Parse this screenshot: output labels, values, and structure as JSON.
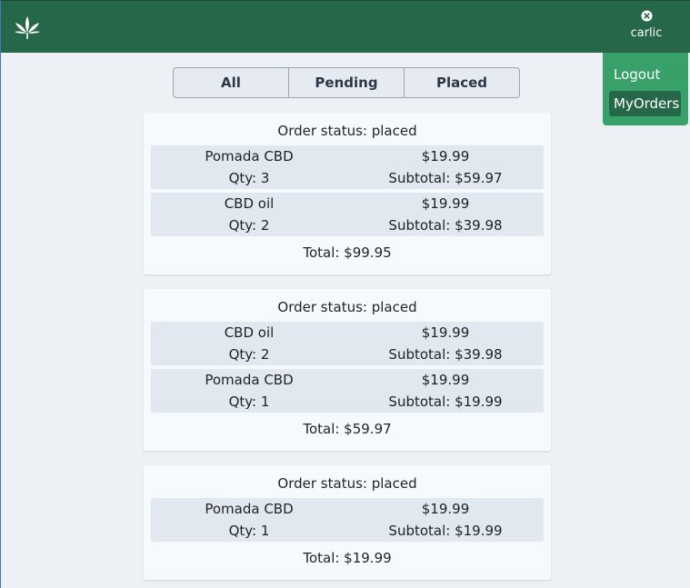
{
  "header": {
    "logo_icon": "cannabis-leaf-icon",
    "close_icon": "close-circle-icon",
    "username": "carlic"
  },
  "menu": {
    "logout_label": "Logout",
    "myorders_label": "MyOrders"
  },
  "tabs": [
    {
      "label": "All"
    },
    {
      "label": "Pending"
    },
    {
      "label": "Placed"
    }
  ],
  "orders": [
    {
      "status": "Order status: placed",
      "items": [
        {
          "name": "Pomada CBD",
          "price": "$19.99",
          "qty": "Qty: 3",
          "subtotal": "Subtotal: $59.97"
        },
        {
          "name": "CBD oil",
          "price": "$19.99",
          "qty": "Qty: 2",
          "subtotal": "Subtotal: $39.98"
        }
      ],
      "total": "Total: $99.95"
    },
    {
      "status": "Order status: placed",
      "items": [
        {
          "name": "CBD oil",
          "price": "$19.99",
          "qty": "Qty: 2",
          "subtotal": "Subtotal: $39.98"
        },
        {
          "name": "Pomada CBD",
          "price": "$19.99",
          "qty": "Qty: 1",
          "subtotal": "Subtotal: $19.99"
        }
      ],
      "total": "Total: $59.97"
    },
    {
      "status": "Order status: placed",
      "items": [
        {
          "name": "Pomada CBD",
          "price": "$19.99",
          "qty": "Qty: 1",
          "subtotal": "Subtotal: $19.99"
        }
      ],
      "total": "Total: $19.99"
    }
  ],
  "colors": {
    "header": "#276749",
    "menu": "#38a169",
    "menu_active": "#276749",
    "page_bg": "#edf1f5",
    "card_bg": "#f7fafc",
    "row_bg": "#e2e8f0"
  }
}
